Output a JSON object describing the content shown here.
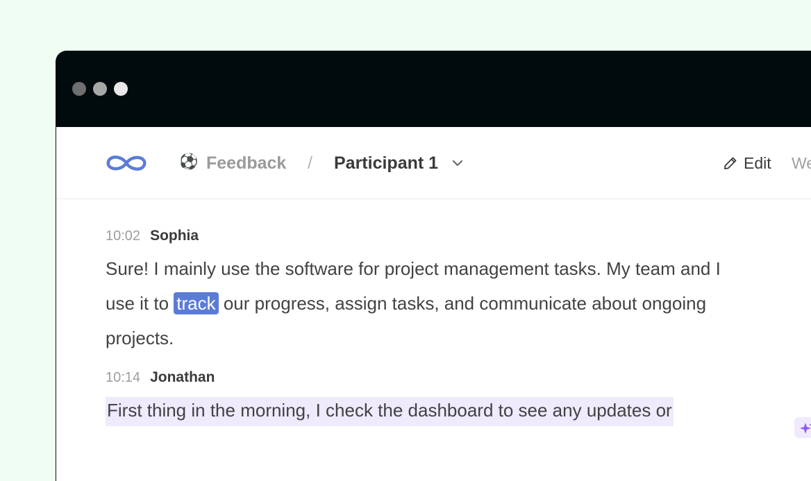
{
  "window": {
    "controls": [
      "close",
      "minimize",
      "maximize"
    ]
  },
  "toolbar": {
    "logo_icon": "infinity-icon",
    "project_emoji": "⚽",
    "project_name": "Feedback",
    "separator": "/",
    "current_page": "Participant 1",
    "edit_label": "Edit",
    "extra_label": "We"
  },
  "transcript": {
    "entries": [
      {
        "time": "10:02",
        "speaker": "Sophia",
        "text_before": "Sure! I mainly use the software for project management tasks. My team and I use it to ",
        "highlight_word": "track",
        "text_after": " our progress, assign tasks, and communicate about ongoing projects."
      },
      {
        "time": "10:14",
        "speaker": "Jonathan",
        "text": "First thing in the morning, I check the dashboard to see any updates or"
      }
    ]
  },
  "colors": {
    "background": "#effdf2",
    "titlebar": "#010b0d",
    "accent": "#5b7cd6",
    "highlight_line": "#efeafc"
  }
}
